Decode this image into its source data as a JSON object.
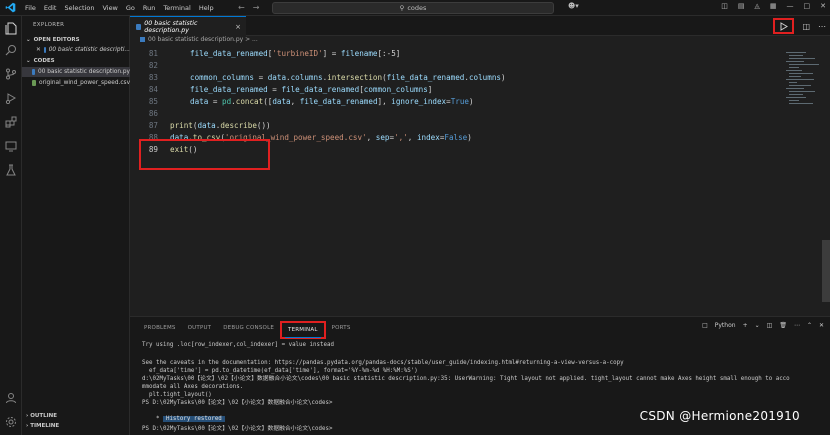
{
  "titlebar": {
    "menu": [
      "File",
      "Edit",
      "Selection",
      "View",
      "Go",
      "Run",
      "Terminal",
      "Help"
    ],
    "search_text": "codes"
  },
  "sidebar": {
    "title": "EXPLORER",
    "open_editors_label": "OPEN EDITORS",
    "open_editor_file": "00 basic statistic descripti...",
    "folder_label": "CODES",
    "files": [
      "00 basic statistic description.py",
      "original_wind_power_speed.csv"
    ],
    "outline_label": "OUTLINE",
    "timeline_label": "TIMELINE"
  },
  "tab": {
    "label": "00 basic statistic description.py",
    "close": "×"
  },
  "breadcrumb": "00 basic statistic description.py > ...",
  "editor": {
    "lines": [
      {
        "n": "81",
        "indent": 1,
        "tokens": [
          [
            "var",
            "file_data_renamed"
          ],
          [
            "op",
            "["
          ],
          [
            "str",
            "'turbineID'"
          ],
          [
            "op",
            "] = "
          ],
          [
            "var",
            "filename"
          ],
          [
            "op",
            "[:-5]"
          ]
        ]
      },
      {
        "n": "82",
        "indent": 0,
        "tokens": []
      },
      {
        "n": "83",
        "indent": 1,
        "tokens": [
          [
            "var",
            "common_columns"
          ],
          [
            "op",
            " = "
          ],
          [
            "var",
            "data"
          ],
          [
            "op",
            "."
          ],
          [
            "var",
            "columns"
          ],
          [
            "op",
            "."
          ],
          [
            "fn",
            "intersection"
          ],
          [
            "op",
            "("
          ],
          [
            "var",
            "file_data_renamed"
          ],
          [
            "op",
            "."
          ],
          [
            "var",
            "columns"
          ],
          [
            "op",
            ")"
          ]
        ]
      },
      {
        "n": "84",
        "indent": 1,
        "tokens": [
          [
            "var",
            "file_data_renamed"
          ],
          [
            "op",
            " = "
          ],
          [
            "var",
            "file_data_renamed"
          ],
          [
            "op",
            "["
          ],
          [
            "var",
            "common_columns"
          ],
          [
            "op",
            "]"
          ]
        ]
      },
      {
        "n": "85",
        "indent": 1,
        "tokens": [
          [
            "var",
            "data"
          ],
          [
            "op",
            " = "
          ],
          [
            "ty",
            "pd"
          ],
          [
            "op",
            "."
          ],
          [
            "fn",
            "concat"
          ],
          [
            "op",
            "(["
          ],
          [
            "var",
            "data"
          ],
          [
            "op",
            ", "
          ],
          [
            "var",
            "file_data_renamed"
          ],
          [
            "op",
            "], "
          ],
          [
            "var",
            "ignore_index"
          ],
          [
            "op",
            "="
          ],
          [
            "kw",
            "True"
          ],
          [
            "op",
            ")"
          ]
        ]
      },
      {
        "n": "86",
        "indent": 0,
        "tokens": []
      },
      {
        "n": "87",
        "indent": 0,
        "tokens": [
          [
            "fn",
            "print"
          ],
          [
            "op",
            "("
          ],
          [
            "var",
            "data"
          ],
          [
            "op",
            "."
          ],
          [
            "fn",
            "describe"
          ],
          [
            "op",
            "())"
          ]
        ]
      },
      {
        "n": "88",
        "indent": 0,
        "tokens": [
          [
            "var",
            "data"
          ],
          [
            "op",
            "."
          ],
          [
            "fn",
            "to_csv"
          ],
          [
            "op",
            "("
          ],
          [
            "str",
            "'original_wind_power_speed.csv'"
          ],
          [
            "op",
            ", "
          ],
          [
            "var",
            "sep"
          ],
          [
            "op",
            "="
          ],
          [
            "str",
            "','"
          ],
          [
            "op",
            ", "
          ],
          [
            "var",
            "index"
          ],
          [
            "op",
            "="
          ],
          [
            "kw",
            "False"
          ],
          [
            "op",
            ")"
          ]
        ]
      },
      {
        "n": "89",
        "indent": 0,
        "tokens": [
          [
            "fn",
            "exit"
          ],
          [
            "op",
            "()"
          ]
        ]
      }
    ]
  },
  "panel": {
    "tabs": [
      "PROBLEMS",
      "OUTPUT",
      "DEBUG CONSOLE",
      "TERMINAL",
      "PORTS"
    ],
    "active_tab": "TERMINAL",
    "terminal_profile": "Python",
    "terminal_lines": [
      "Try using .loc[row_indexer,col_indexer] = value instead",
      "",
      "See the caveats in the documentation: https://pandas.pydata.org/pandas-docs/stable/user_guide/indexing.html#returning-a-view-versus-a-copy",
      "  ef_data['time'] = pd.to_datetime(ef_data['time'], format='%Y-%m-%d %H:%M:%S')",
      "d:\\02MyTasks\\00【论文】\\02【小论文】数据融合小论文\\codes\\00 basic statistic description.py:35: UserWarning: Tight layout not applied. tight_layout cannot make Axes height small enough to acco",
      "mmodate all Axes decorations.",
      "  plt.tight_layout()",
      "PS D:\\02MyTasks\\00【论文】\\02【小论文】数据融合小论文\\codes>"
    ],
    "history_badge": "History restored",
    "last_prompt": "PS D:\\02MyTasks\\00【论文】\\02【小论文】数据融合小论文\\codes>"
  },
  "watermark": "CSDN @Hermione201910"
}
